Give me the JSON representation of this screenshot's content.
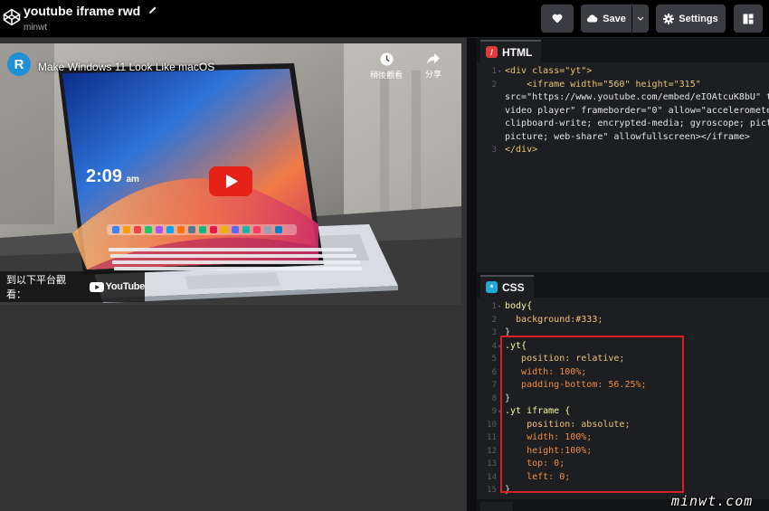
{
  "header": {
    "title": "youtube iframe rwd",
    "owner": "minwt",
    "save_label": "Save",
    "settings_label": "Settings",
    "icons": {
      "logo": "codepen-logo-icon",
      "edit": "pencil-icon",
      "heart": "heart-icon",
      "cloud": "cloud-icon",
      "caret": "chevron-down-icon",
      "gear": "gear-icon",
      "layout": "layout-icon"
    }
  },
  "preview": {
    "video_title": "Make Windows 11 Look Like macOS",
    "channel_initial": "R",
    "watch_later_label": "稍後觀看",
    "share_label": "分享",
    "watch_on_label": "到以下平台觀看：",
    "youtube_label": "YouTube",
    "screen_time": "2:09",
    "screen_ampm": "am",
    "colors": {
      "play_button": "#e62117",
      "background": "#333333"
    }
  },
  "html_panel": {
    "label": "HTML",
    "badge_color": "#e03b3b",
    "lines": [
      {
        "n": "1",
        "text": "<div class=\"yt\">"
      },
      {
        "n": "2",
        "text": "    <iframe width=\"560\" height=\"315\""
      },
      {
        "n": "",
        "text": "src=\"https://www.youtube.com/embed/eIOAtcuK8bU\" ti"
      },
      {
        "n": "",
        "text": "video player\" frameborder=\"0\" allow=\"accelerometer"
      },
      {
        "n": "",
        "text": "clipboard-write; encrypted-media; gyroscope; pictu"
      },
      {
        "n": "",
        "text": "picture; web-share\" allowfullscreen></iframe>"
      },
      {
        "n": "3",
        "text": "</div>"
      }
    ]
  },
  "css_panel": {
    "label": "CSS",
    "badge_color": "#21a8d9",
    "lines": [
      {
        "n": "1",
        "text": "body{"
      },
      {
        "n": "2",
        "text": "  background:#333;"
      },
      {
        "n": "3",
        "text": "}"
      },
      {
        "n": "4",
        "text": ".yt{"
      },
      {
        "n": "5",
        "text": "   position: relative;"
      },
      {
        "n": "6",
        "text": "   width: 100%;"
      },
      {
        "n": "7",
        "text": "   padding-bottom: 56.25%;"
      },
      {
        "n": "8",
        "text": "}"
      },
      {
        "n": "9",
        "text": ".yt iframe {"
      },
      {
        "n": "10",
        "text": "    position: absolute;"
      },
      {
        "n": "11",
        "text": "    width: 100%;"
      },
      {
        "n": "12",
        "text": "    height:100%;"
      },
      {
        "n": "13",
        "text": "    top: 0;"
      },
      {
        "n": "14",
        "text": "    left: 0;"
      },
      {
        "n": "15",
        "text": "}"
      }
    ]
  },
  "watermark": "minwt.com"
}
